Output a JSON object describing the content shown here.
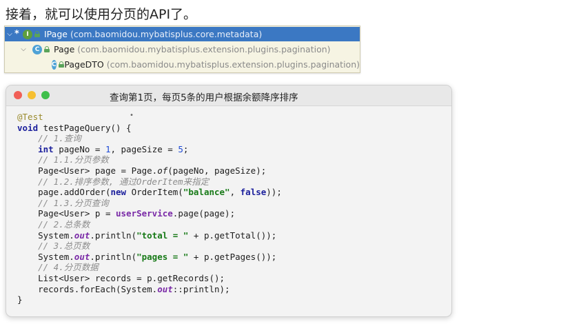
{
  "heading": "接着，就可以使用分页的API了。",
  "hierarchy": {
    "rows": [
      {
        "name": "IPage",
        "package": "(com.baomidou.mybatisplus.core.metadata)",
        "kind": "I"
      },
      {
        "name": "Page",
        "package": "(com.baomidou.mybatisplus.extension.plugins.pagination)",
        "kind": "C"
      },
      {
        "name": "PageDTO",
        "package": "(com.baomidou.mybatisplus.extension.plugins.pagination)",
        "kind": "C"
      }
    ]
  },
  "window": {
    "title": "查询第1页，每页5条的用户根据余额降序排序",
    "colors": {
      "close": "#f15f57",
      "minimize": "#f6bf31",
      "zoom": "#3ebf4a"
    }
  },
  "code": {
    "annotation": "@Test",
    "kw_void": "void",
    "kw_int": "int",
    "kw_new": "new",
    "kw_false": "false",
    "method_sig": " testPageQuery() {",
    "c1": "// 1.查询",
    "l_int_a": " pageNo = ",
    "n1": "1",
    "l_int_b": ", pageSize = ",
    "n5": "5",
    "semi": ";",
    "c11": "// 1.1.分页参数",
    "l_page_a": "Page<User> page = Page.",
    "of": "of",
    "l_page_b": "(pageNo, pageSize);",
    "c12": "// 1.2.排序参数, 通过OrderItem来指定",
    "l_order_a": "page.addOrder(",
    "l_order_b": " OrderItem(",
    "s_balance": "\"balance\"",
    "comma": ", ",
    "l_order_c": "));",
    "c13": "// 1.3.分页查询",
    "l_query_a": "Page<User> p = ",
    "svc": "userService",
    "l_query_b": ".page(page);",
    "c2": "// 2.总条数",
    "sys": "System.",
    "out": "out",
    "println_open": ".println(",
    "s_total": "\"total = \"",
    "l_total_b": " + p.getTotal());",
    "c3": "// 3.总页数",
    "s_pages": "\"pages = \"",
    "l_pages_b": " + p.getPages());",
    "c4": "// 4.分页数据",
    "l_list": "List<User> records = p.getRecords();",
    "l_each_a": "records.forEach(System.",
    "l_each_b": "::println);",
    "close": "}"
  }
}
